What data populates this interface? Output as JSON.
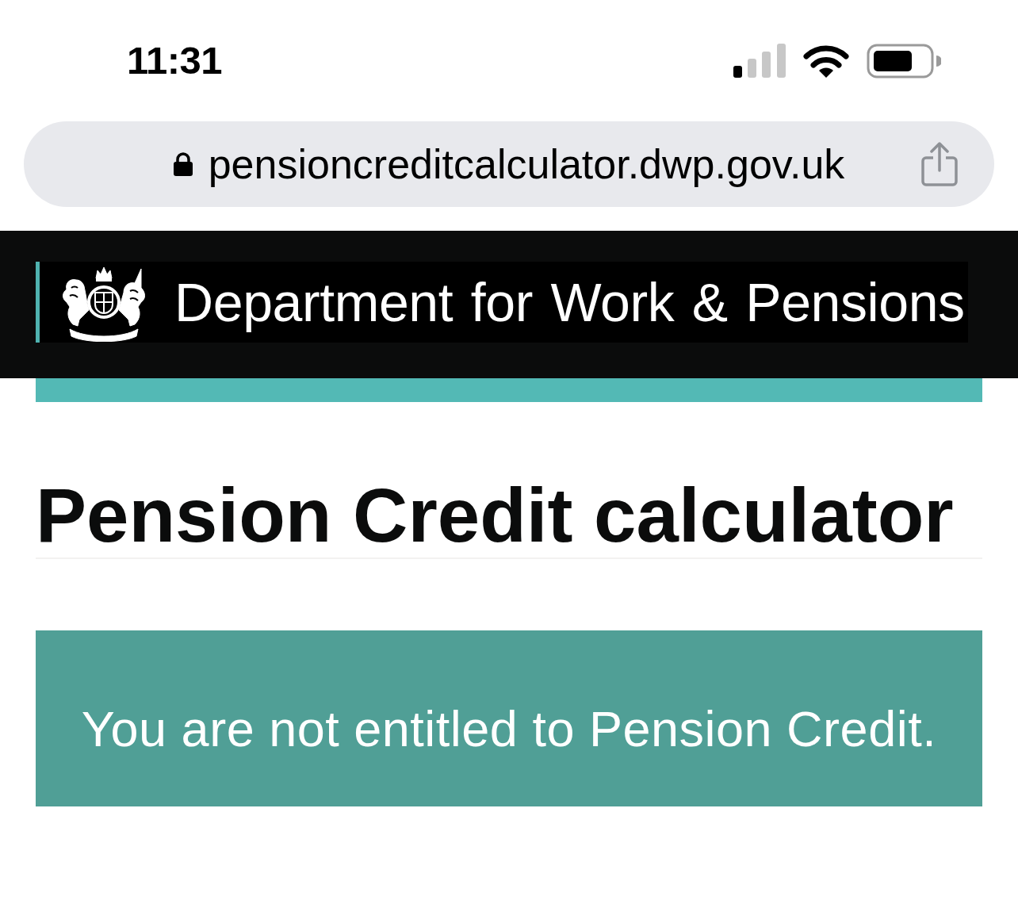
{
  "status_bar": {
    "time": "11:31"
  },
  "address_bar": {
    "url": "pensioncreditcalculator.dwp.gov.uk"
  },
  "header": {
    "logo_text": "Department for Work & Pensions"
  },
  "page": {
    "title": "Pension Credit calculator",
    "result": "You are not entitled to Pension Credit."
  }
}
